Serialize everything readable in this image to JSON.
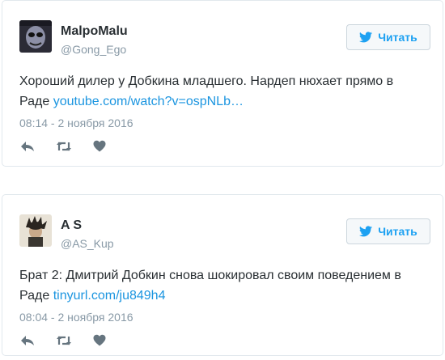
{
  "tweets": [
    {
      "name": "MalpoMalu",
      "handle": "@Gong_Ego",
      "follow_label": "Читать",
      "text": "Хороший дилер у Добкина младшего. Нардеп нюхает прямо в Раде ",
      "link": "youtube.com/watch?v=ospNLb…",
      "time": "08:14 - 2 ноября 2016",
      "icons": [
        "reply-icon",
        "retweet-icon",
        "like-icon"
      ]
    },
    {
      "name": "A S",
      "handle": "@AS_Kup",
      "follow_label": "Читать",
      "text": "Брат 2: Дмитрий Добкин снова шокировал своим поведением в Раде ",
      "link": "tinyurl.com/ju849h4",
      "time": "08:04 - 2 ноября 2016",
      "icons": [
        "reply-icon",
        "retweet-icon",
        "like-icon"
      ]
    }
  ],
  "colors": {
    "accent": "#1da1f2",
    "link": "#1b95e0",
    "muted": "#8899a6",
    "icon": "#66757f",
    "border": "#e1e8ed"
  }
}
